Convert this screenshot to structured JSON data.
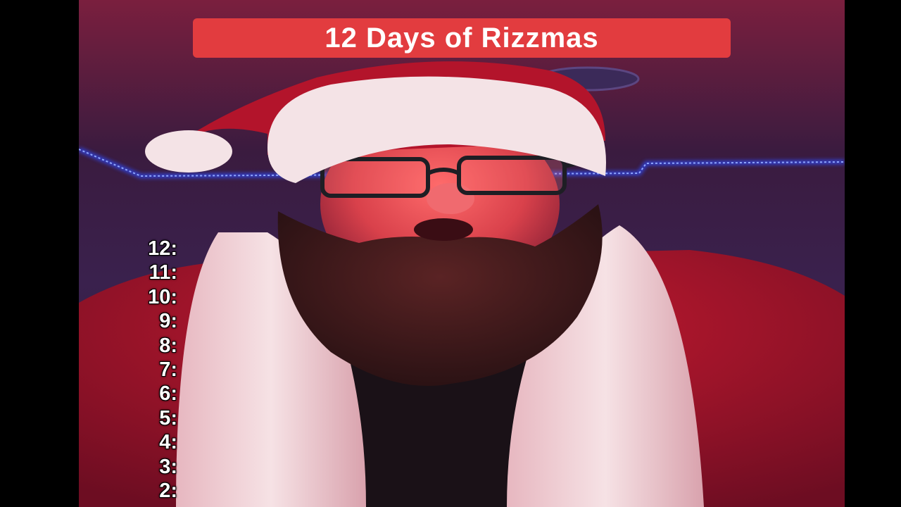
{
  "video": {
    "caption_title": "12 Days of Rizzmas",
    "countdown": [
      "12:",
      "11:",
      "10:",
      "9:",
      "8:",
      "7:",
      "6:",
      "5:",
      "4:",
      "3:",
      "2:"
    ]
  },
  "colors": {
    "letterbox": "#000000",
    "banner": "#e23c3f",
    "led_strip": "#3b5cff",
    "suit_red": "#a8132a",
    "fur_white": "#f2d8dc"
  }
}
